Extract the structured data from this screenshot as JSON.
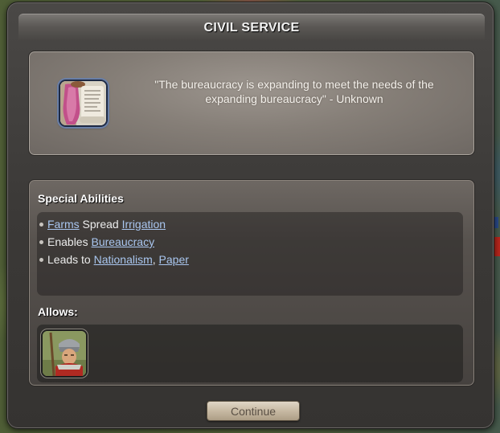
{
  "dialog": {
    "title": "CIVIL SERVICE",
    "quote": "\"The bureaucracy is expanding to meet the needs of the expanding bureaucracy\" - Unknown",
    "tech_icon": "civil-service-scroll-icon",
    "special_abilities": {
      "heading": "Special Abilities",
      "lines": [
        {
          "parts": [
            {
              "text": "Farms",
              "link": true
            },
            {
              "text": " Spread ",
              "link": false
            },
            {
              "text": "Irrigation",
              "link": true
            }
          ]
        },
        {
          "parts": [
            {
              "text": "Enables ",
              "link": false
            },
            {
              "text": "Bureaucracy",
              "link": true
            }
          ]
        },
        {
          "parts": [
            {
              "text": "Leads to ",
              "link": false
            },
            {
              "text": "Nationalism",
              "link": true
            },
            {
              "text": ", ",
              "link": false
            },
            {
              "text": "Paper",
              "link": true
            }
          ]
        }
      ]
    },
    "allows": {
      "heading": "Allows:",
      "units": [
        {
          "icon": "pikeman-unit-icon"
        }
      ]
    },
    "continue_label": "Continue"
  },
  "colors": {
    "link": "#a9c6ef",
    "panel_dark": "#3b3937",
    "button_top": "#e0d6c6"
  }
}
